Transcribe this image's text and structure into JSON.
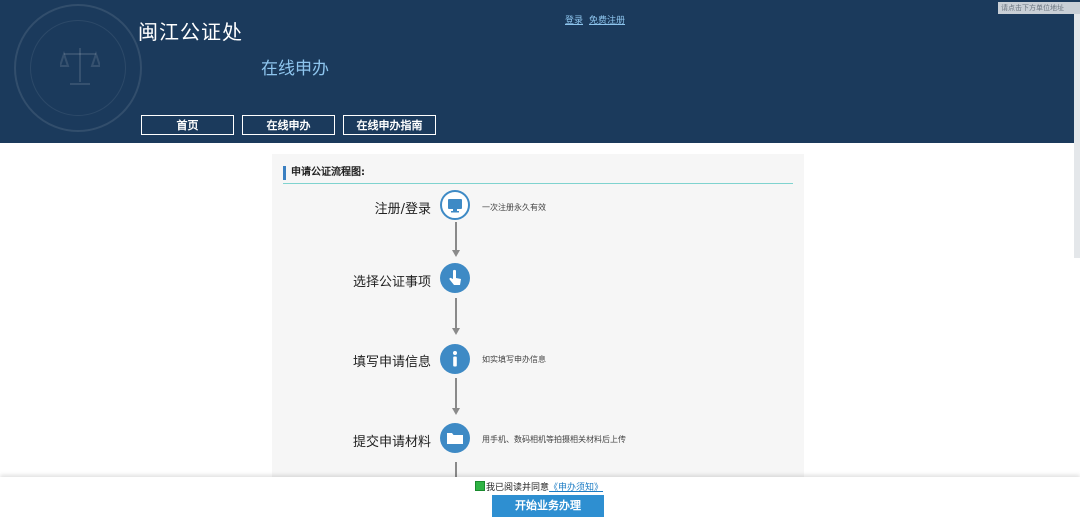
{
  "header": {
    "site_title": "闽江公证处",
    "subtitle": "在线申办",
    "login": "登录",
    "register": "免费注册",
    "corner_text": "请点击下方单位地址",
    "nav": [
      "首页",
      "在线申办",
      "在线申办指南"
    ],
    "background_color": "#1b3a5c"
  },
  "flow": {
    "title": "申请公证流程图:",
    "steps": [
      {
        "label": "注册/登录",
        "icon": "monitor-icon",
        "note": "一次注册永久有效"
      },
      {
        "label": "选择公证事项",
        "icon": "hand-pointer-icon",
        "note": ""
      },
      {
        "label": "填写申请信息",
        "icon": "info-icon",
        "note": "如实填写申办信息"
      },
      {
        "label": "提交申请材料",
        "icon": "folder-icon",
        "note": "用手机、数码相机等拍摄相关材料后上传"
      }
    ]
  },
  "footer": {
    "agree_text": "我已阅读并同意",
    "agree_link": "《申办须知》",
    "start_button": "开始业务办理",
    "accent_color": "#2e8fd1"
  }
}
